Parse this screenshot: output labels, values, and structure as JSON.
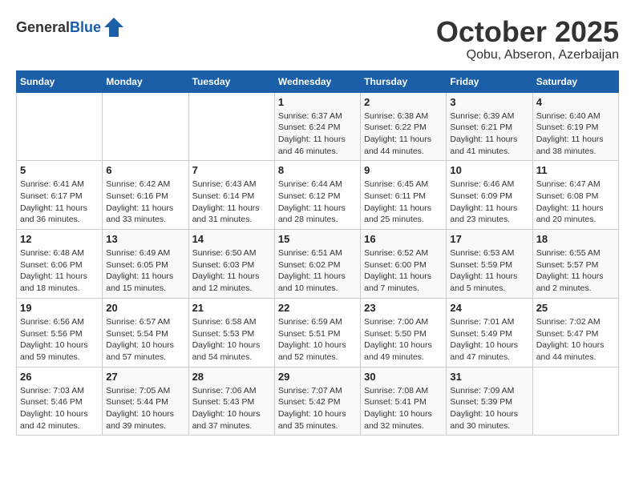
{
  "logo": {
    "general": "General",
    "blue": "Blue"
  },
  "title": "October 2025",
  "subtitle": "Qobu, Abseron, Azerbaijan",
  "days_of_week": [
    "Sunday",
    "Monday",
    "Tuesday",
    "Wednesday",
    "Thursday",
    "Friday",
    "Saturday"
  ],
  "weeks": [
    [
      {
        "day": "",
        "info": ""
      },
      {
        "day": "",
        "info": ""
      },
      {
        "day": "",
        "info": ""
      },
      {
        "day": "1",
        "info": "Sunrise: 6:37 AM\nSunset: 6:24 PM\nDaylight: 11 hours\nand 46 minutes."
      },
      {
        "day": "2",
        "info": "Sunrise: 6:38 AM\nSunset: 6:22 PM\nDaylight: 11 hours\nand 44 minutes."
      },
      {
        "day": "3",
        "info": "Sunrise: 6:39 AM\nSunset: 6:21 PM\nDaylight: 11 hours\nand 41 minutes."
      },
      {
        "day": "4",
        "info": "Sunrise: 6:40 AM\nSunset: 6:19 PM\nDaylight: 11 hours\nand 38 minutes."
      }
    ],
    [
      {
        "day": "5",
        "info": "Sunrise: 6:41 AM\nSunset: 6:17 PM\nDaylight: 11 hours\nand 36 minutes."
      },
      {
        "day": "6",
        "info": "Sunrise: 6:42 AM\nSunset: 6:16 PM\nDaylight: 11 hours\nand 33 minutes."
      },
      {
        "day": "7",
        "info": "Sunrise: 6:43 AM\nSunset: 6:14 PM\nDaylight: 11 hours\nand 31 minutes."
      },
      {
        "day": "8",
        "info": "Sunrise: 6:44 AM\nSunset: 6:12 PM\nDaylight: 11 hours\nand 28 minutes."
      },
      {
        "day": "9",
        "info": "Sunrise: 6:45 AM\nSunset: 6:11 PM\nDaylight: 11 hours\nand 25 minutes."
      },
      {
        "day": "10",
        "info": "Sunrise: 6:46 AM\nSunset: 6:09 PM\nDaylight: 11 hours\nand 23 minutes."
      },
      {
        "day": "11",
        "info": "Sunrise: 6:47 AM\nSunset: 6:08 PM\nDaylight: 11 hours\nand 20 minutes."
      }
    ],
    [
      {
        "day": "12",
        "info": "Sunrise: 6:48 AM\nSunset: 6:06 PM\nDaylight: 11 hours\nand 18 minutes."
      },
      {
        "day": "13",
        "info": "Sunrise: 6:49 AM\nSunset: 6:05 PM\nDaylight: 11 hours\nand 15 minutes."
      },
      {
        "day": "14",
        "info": "Sunrise: 6:50 AM\nSunset: 6:03 PM\nDaylight: 11 hours\nand 12 minutes."
      },
      {
        "day": "15",
        "info": "Sunrise: 6:51 AM\nSunset: 6:02 PM\nDaylight: 11 hours\nand 10 minutes."
      },
      {
        "day": "16",
        "info": "Sunrise: 6:52 AM\nSunset: 6:00 PM\nDaylight: 11 hours\nand 7 minutes."
      },
      {
        "day": "17",
        "info": "Sunrise: 6:53 AM\nSunset: 5:59 PM\nDaylight: 11 hours\nand 5 minutes."
      },
      {
        "day": "18",
        "info": "Sunrise: 6:55 AM\nSunset: 5:57 PM\nDaylight: 11 hours\nand 2 minutes."
      }
    ],
    [
      {
        "day": "19",
        "info": "Sunrise: 6:56 AM\nSunset: 5:56 PM\nDaylight: 10 hours\nand 59 minutes."
      },
      {
        "day": "20",
        "info": "Sunrise: 6:57 AM\nSunset: 5:54 PM\nDaylight: 10 hours\nand 57 minutes."
      },
      {
        "day": "21",
        "info": "Sunrise: 6:58 AM\nSunset: 5:53 PM\nDaylight: 10 hours\nand 54 minutes."
      },
      {
        "day": "22",
        "info": "Sunrise: 6:59 AM\nSunset: 5:51 PM\nDaylight: 10 hours\nand 52 minutes."
      },
      {
        "day": "23",
        "info": "Sunrise: 7:00 AM\nSunset: 5:50 PM\nDaylight: 10 hours\nand 49 minutes."
      },
      {
        "day": "24",
        "info": "Sunrise: 7:01 AM\nSunset: 5:49 PM\nDaylight: 10 hours\nand 47 minutes."
      },
      {
        "day": "25",
        "info": "Sunrise: 7:02 AM\nSunset: 5:47 PM\nDaylight: 10 hours\nand 44 minutes."
      }
    ],
    [
      {
        "day": "26",
        "info": "Sunrise: 7:03 AM\nSunset: 5:46 PM\nDaylight: 10 hours\nand 42 minutes."
      },
      {
        "day": "27",
        "info": "Sunrise: 7:05 AM\nSunset: 5:44 PM\nDaylight: 10 hours\nand 39 minutes."
      },
      {
        "day": "28",
        "info": "Sunrise: 7:06 AM\nSunset: 5:43 PM\nDaylight: 10 hours\nand 37 minutes."
      },
      {
        "day": "29",
        "info": "Sunrise: 7:07 AM\nSunset: 5:42 PM\nDaylight: 10 hours\nand 35 minutes."
      },
      {
        "day": "30",
        "info": "Sunrise: 7:08 AM\nSunset: 5:41 PM\nDaylight: 10 hours\nand 32 minutes."
      },
      {
        "day": "31",
        "info": "Sunrise: 7:09 AM\nSunset: 5:39 PM\nDaylight: 10 hours\nand 30 minutes."
      },
      {
        "day": "",
        "info": ""
      }
    ]
  ]
}
